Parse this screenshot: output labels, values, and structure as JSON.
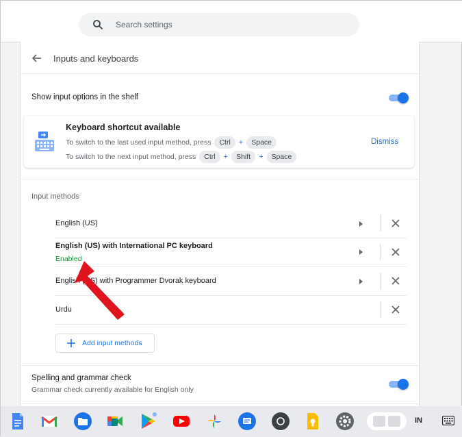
{
  "search": {
    "placeholder": "Search settings",
    "icon": "search-icon"
  },
  "page": {
    "title": "Inputs and keyboards"
  },
  "shelf_option": {
    "label": "Show input options in the shelf",
    "enabled": true
  },
  "shortcut_card": {
    "title": "Keyboard shortcut available",
    "hint_last": "To switch to the last used input method, press",
    "hint_last_keys": [
      "Ctrl",
      "Space"
    ],
    "hint_next": "To switch to the next input method, press",
    "hint_next_keys": [
      "Ctrl",
      "Shift",
      "Space"
    ],
    "plus": "+",
    "dismiss": "Dismiss"
  },
  "input_methods": {
    "section_label": "Input methods",
    "items": [
      {
        "name": "English (US)",
        "status": ""
      },
      {
        "name": "English (US) with International PC keyboard",
        "status": "Enabled"
      },
      {
        "name": "English (US) with Programmer Dvorak keyboard",
        "status": ""
      },
      {
        "name": "Urdu",
        "status": ""
      }
    ],
    "add_label": "Add input methods"
  },
  "spelling": {
    "label": "Spelling and grammar check",
    "sub": "Grammar check currently available for English only",
    "enabled": true
  },
  "tray": {
    "ime": "IN"
  },
  "colors": {
    "accent": "#1a73e8",
    "enabled_text": "#1e8e3e",
    "annotation_arrow": "#e0141e"
  }
}
